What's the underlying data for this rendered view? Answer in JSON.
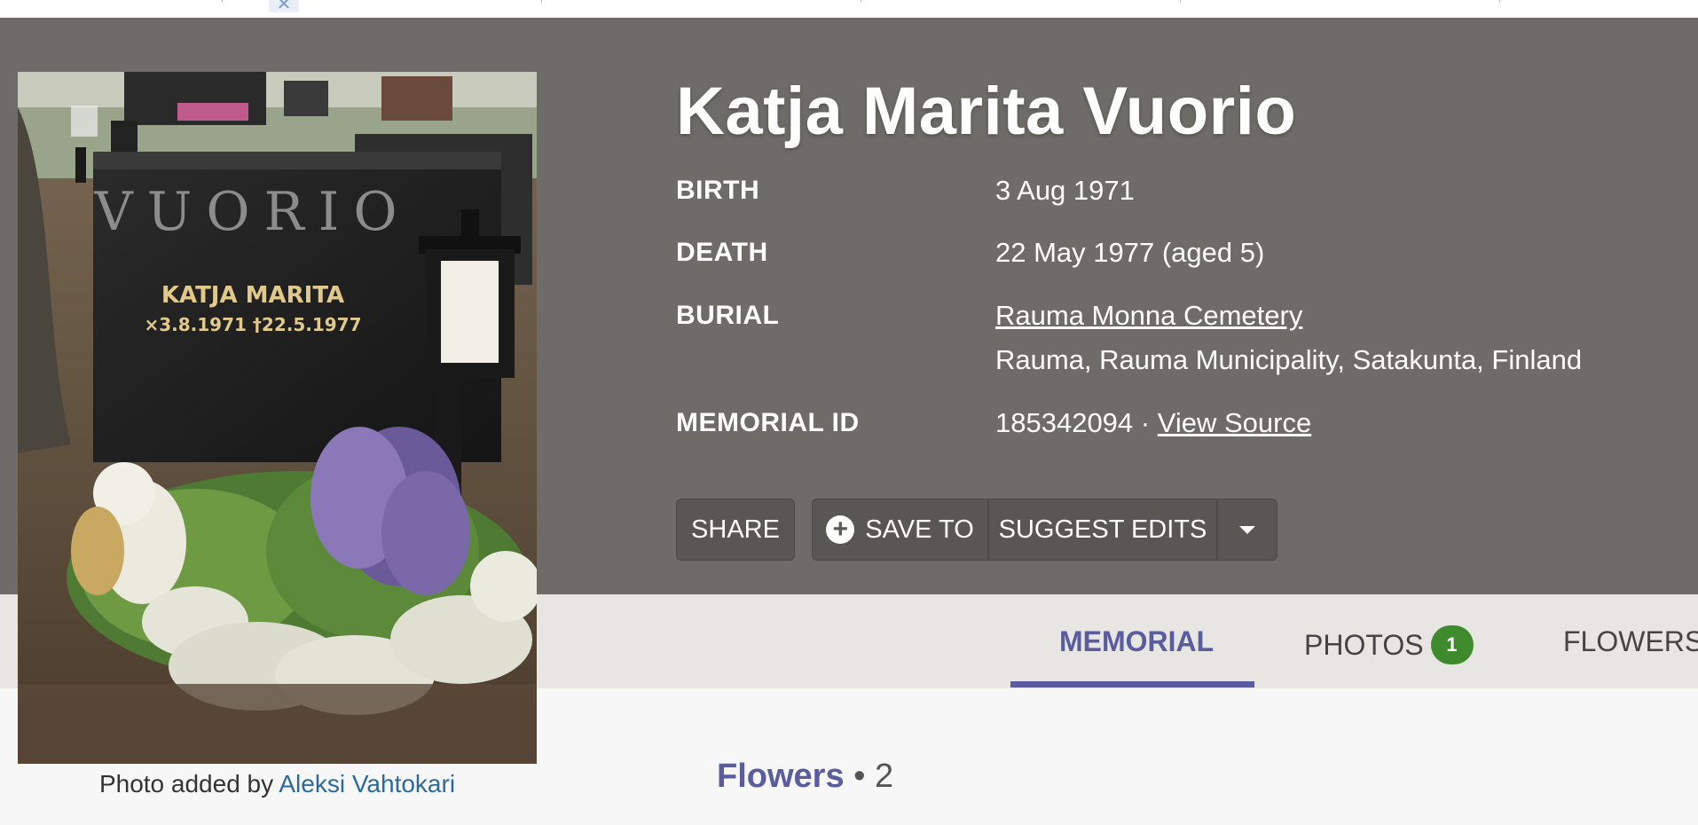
{
  "memorial": {
    "name": "Katja Marita Vuorio",
    "birth_label": "BIRTH",
    "birth_value": "3 Aug 1971",
    "death_label": "DEATH",
    "death_value": "22 May 1977 (aged 5)",
    "burial_label": "BURIAL",
    "cemetery": "Rauma Monna Cemetery",
    "location": "Rauma, Rauma Municipality, Satakunta, Finland",
    "memorial_id_label": "MEMORIAL ID",
    "memorial_id": "185342094",
    "separator": "·",
    "view_source": "View Source"
  },
  "photo": {
    "caption_prefix": "Photo added by",
    "contributor": "Aleksi Vahtokari",
    "stone_name": "VUORIO",
    "stone_person": "KATJA MARITA",
    "stone_dates": "×3.8.1971  †22.5.1977"
  },
  "actions": {
    "share": "SHARE",
    "save_to": "SAVE TO",
    "suggest_edits": "SUGGEST EDITS"
  },
  "tabs": [
    {
      "label": "MEMORIAL",
      "active": true
    },
    {
      "label": "PHOTOS",
      "badge": "1"
    },
    {
      "label": "FLOWERS"
    }
  ],
  "section": {
    "title": "Flowers",
    "bullet": "•",
    "count": "2"
  },
  "colors": {
    "hero_bg": "#6e6c68",
    "accent": "#5a5ca0",
    "badge": "#3e8a2c",
    "link": "#2a6a9c"
  },
  "icons": {
    "save_to": "plus-circle-icon",
    "more": "caret-down-icon",
    "close": "close-icon"
  }
}
